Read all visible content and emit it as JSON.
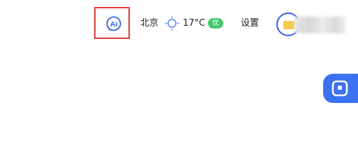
{
  "header": {
    "ai_button": {
      "icon": "ai-chat-icon",
      "label": "Ai"
    },
    "weather": {
      "city": "北京",
      "icon": "sun-icon",
      "temperature": "17°C",
      "air_quality": "优",
      "air_quality_color": "#41c86a"
    },
    "settings_label": "设置",
    "account": {
      "icon": "avatar-icon"
    }
  },
  "floating_widget": {
    "icon": "square-app-icon"
  },
  "colors": {
    "highlight": "#e23b3b",
    "accent": "#2f60e6",
    "sun": "#4c7ff0",
    "widget": "#3c72f0"
  }
}
